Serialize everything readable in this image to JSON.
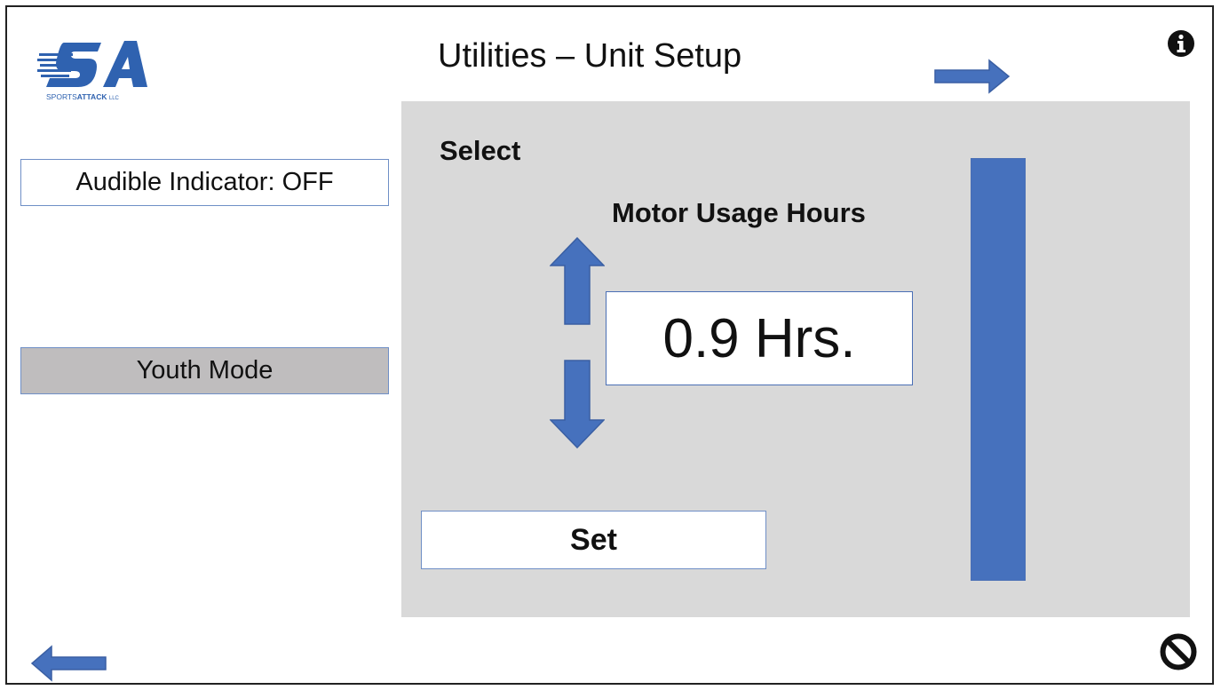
{
  "header": {
    "title": "Utilities – Unit Setup",
    "logo": {
      "monogram": "SA",
      "brand_prefix": "SPORTS",
      "brand_main": "ATTACK",
      "brand_suffix": "LLC",
      "color": "#2f62b0"
    },
    "info_icon": "info-icon",
    "next_icon": "arrow-right-icon"
  },
  "sidebar": {
    "audible_indicator_label": "Audible Indicator: OFF",
    "youth_mode_label": "Youth Mode"
  },
  "panel": {
    "select_label": "Select",
    "parameter_label": "Motor Usage Hours",
    "value_display": "0.9 Hrs.",
    "increment_icon": "arrow-up-icon",
    "decrement_icon": "arrow-down-icon",
    "set_label": "Set",
    "slider": {
      "level_fraction": 1.0
    }
  },
  "footer": {
    "back_icon": "arrow-left-icon",
    "cancel_icon": "cancel-icon"
  },
  "colors": {
    "accent_blue": "#4671bd",
    "panel_gray": "#d9d9d9",
    "youth_mode_gray": "#bfbdbe",
    "frame_border": "#222222"
  }
}
